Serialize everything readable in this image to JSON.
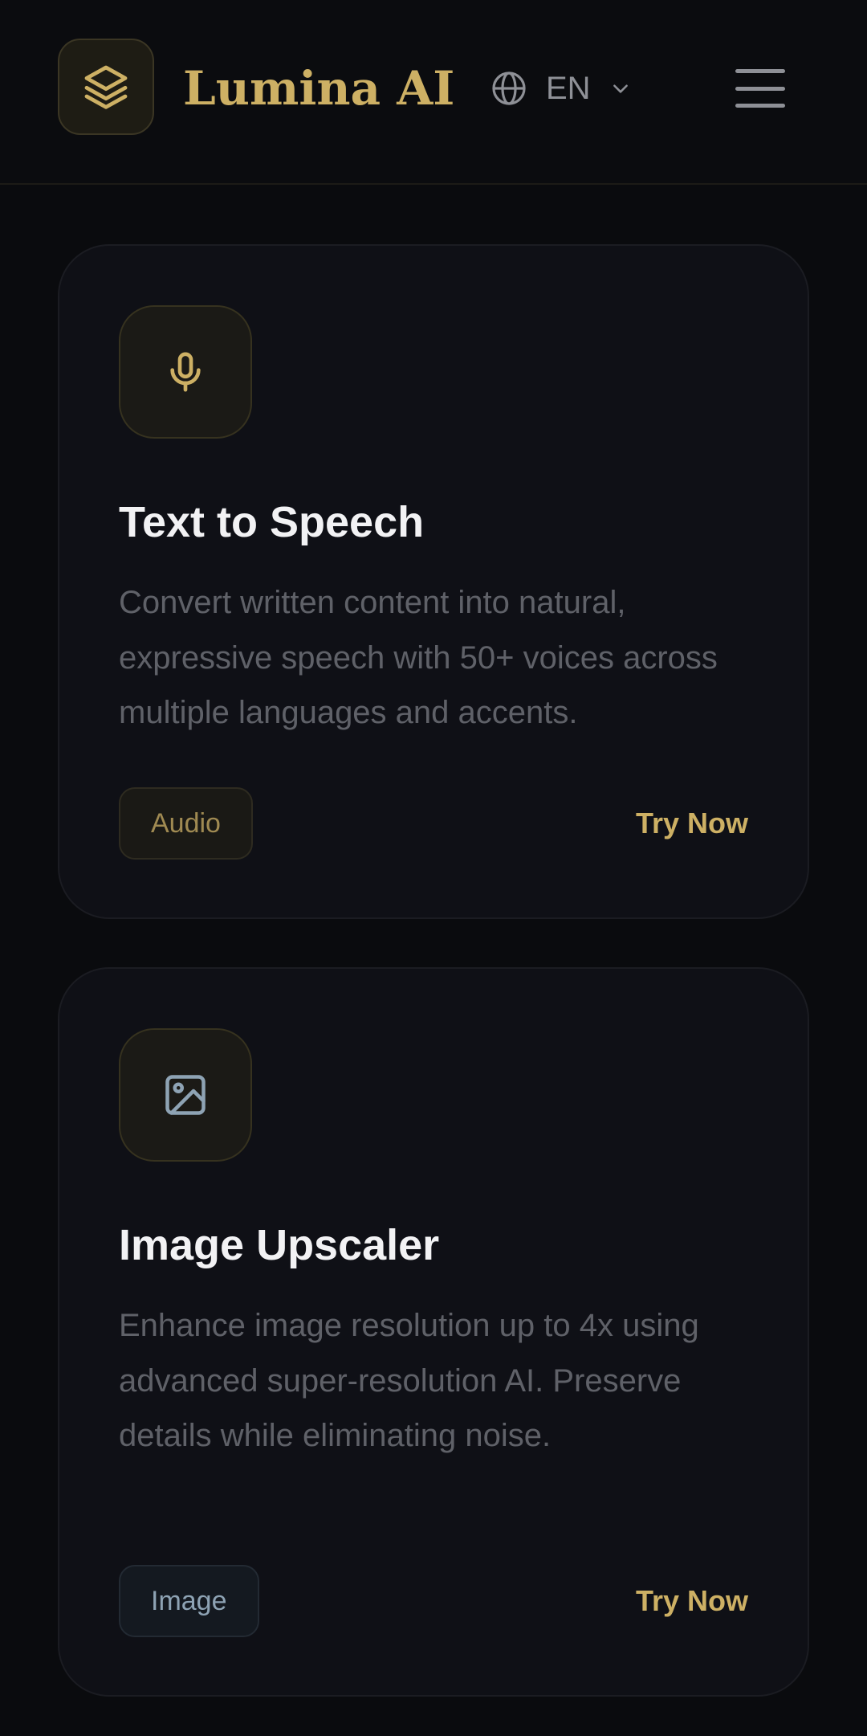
{
  "header": {
    "brand": "Lumina AI",
    "language": "EN",
    "icons": {
      "logo": "layers-icon",
      "language": "globe-icon",
      "dropdown": "chevron-down-icon",
      "menu": "hamburger-menu-icon"
    }
  },
  "cards": [
    {
      "icon": "microphone-icon",
      "title": "Text to Speech",
      "description": "Convert written content into natural, expressive speech with 50+ voices across multiple languages and accents.",
      "tag": "Audio",
      "action": "Try Now"
    },
    {
      "icon": "image-icon",
      "title": "Image Upscaler",
      "description": "Enhance image resolution up to 4x using advanced super-resolution AI. Preserve details while eliminating noise.",
      "tag": "Image",
      "action": "Try Now"
    }
  ],
  "colors": {
    "background": "#0a0b0e",
    "card": "#0f1016",
    "accent_gold": "#cdb064",
    "text_primary": "#f2f2f4",
    "text_muted": "#5f6168",
    "image_tag_text": "#8ea3b4"
  }
}
